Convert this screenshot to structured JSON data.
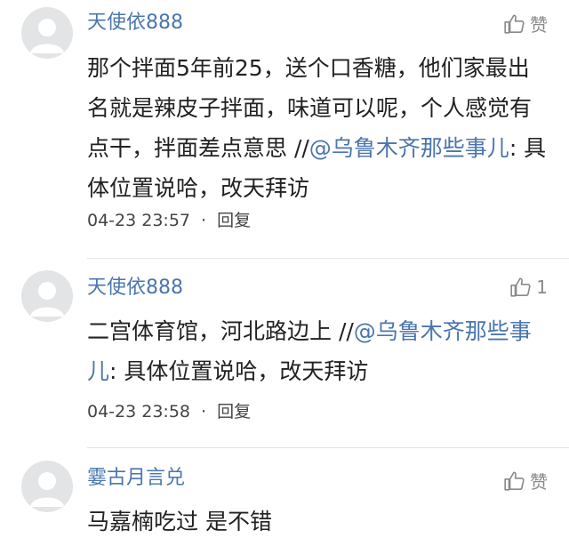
{
  "comments": [
    {
      "username": "天使依888",
      "like_label": "赞",
      "text_before": "那个拌面5年前25，送个口香糖，他们家最出名就是辣皮子拌面，味道可以呢，个人感觉有点干，拌面差点意思 //",
      "mention": "@乌鲁木齐那些事儿",
      "text_after": ": 具体位置说哈，改天拜访",
      "time": "04-23 23:57",
      "separator": "·",
      "reply_label": "回复"
    },
    {
      "username": "天使依888",
      "like_label": "1",
      "text_before": "二宫体育馆，河北路边上 //",
      "mention": "@乌鲁木齐那些事儿",
      "text_after": ": 具体位置说哈，改天拜访",
      "time": "04-23 23:58",
      "separator": "·",
      "reply_label": "回复"
    },
    {
      "username": "霎古月言兑",
      "like_label": "赞",
      "text_before": "马嘉楠吃过  是不错",
      "mention": "",
      "text_after": ""
    }
  ],
  "colors": {
    "username": "#4a76ae",
    "mention": "#4a76ae",
    "text": "#222222",
    "meta": "#444444",
    "like": "#8a8a8a",
    "avatar_bg": "#e3e4e6"
  },
  "icons": {
    "avatar": "default-avatar-icon",
    "like": "thumbs-up-icon"
  }
}
